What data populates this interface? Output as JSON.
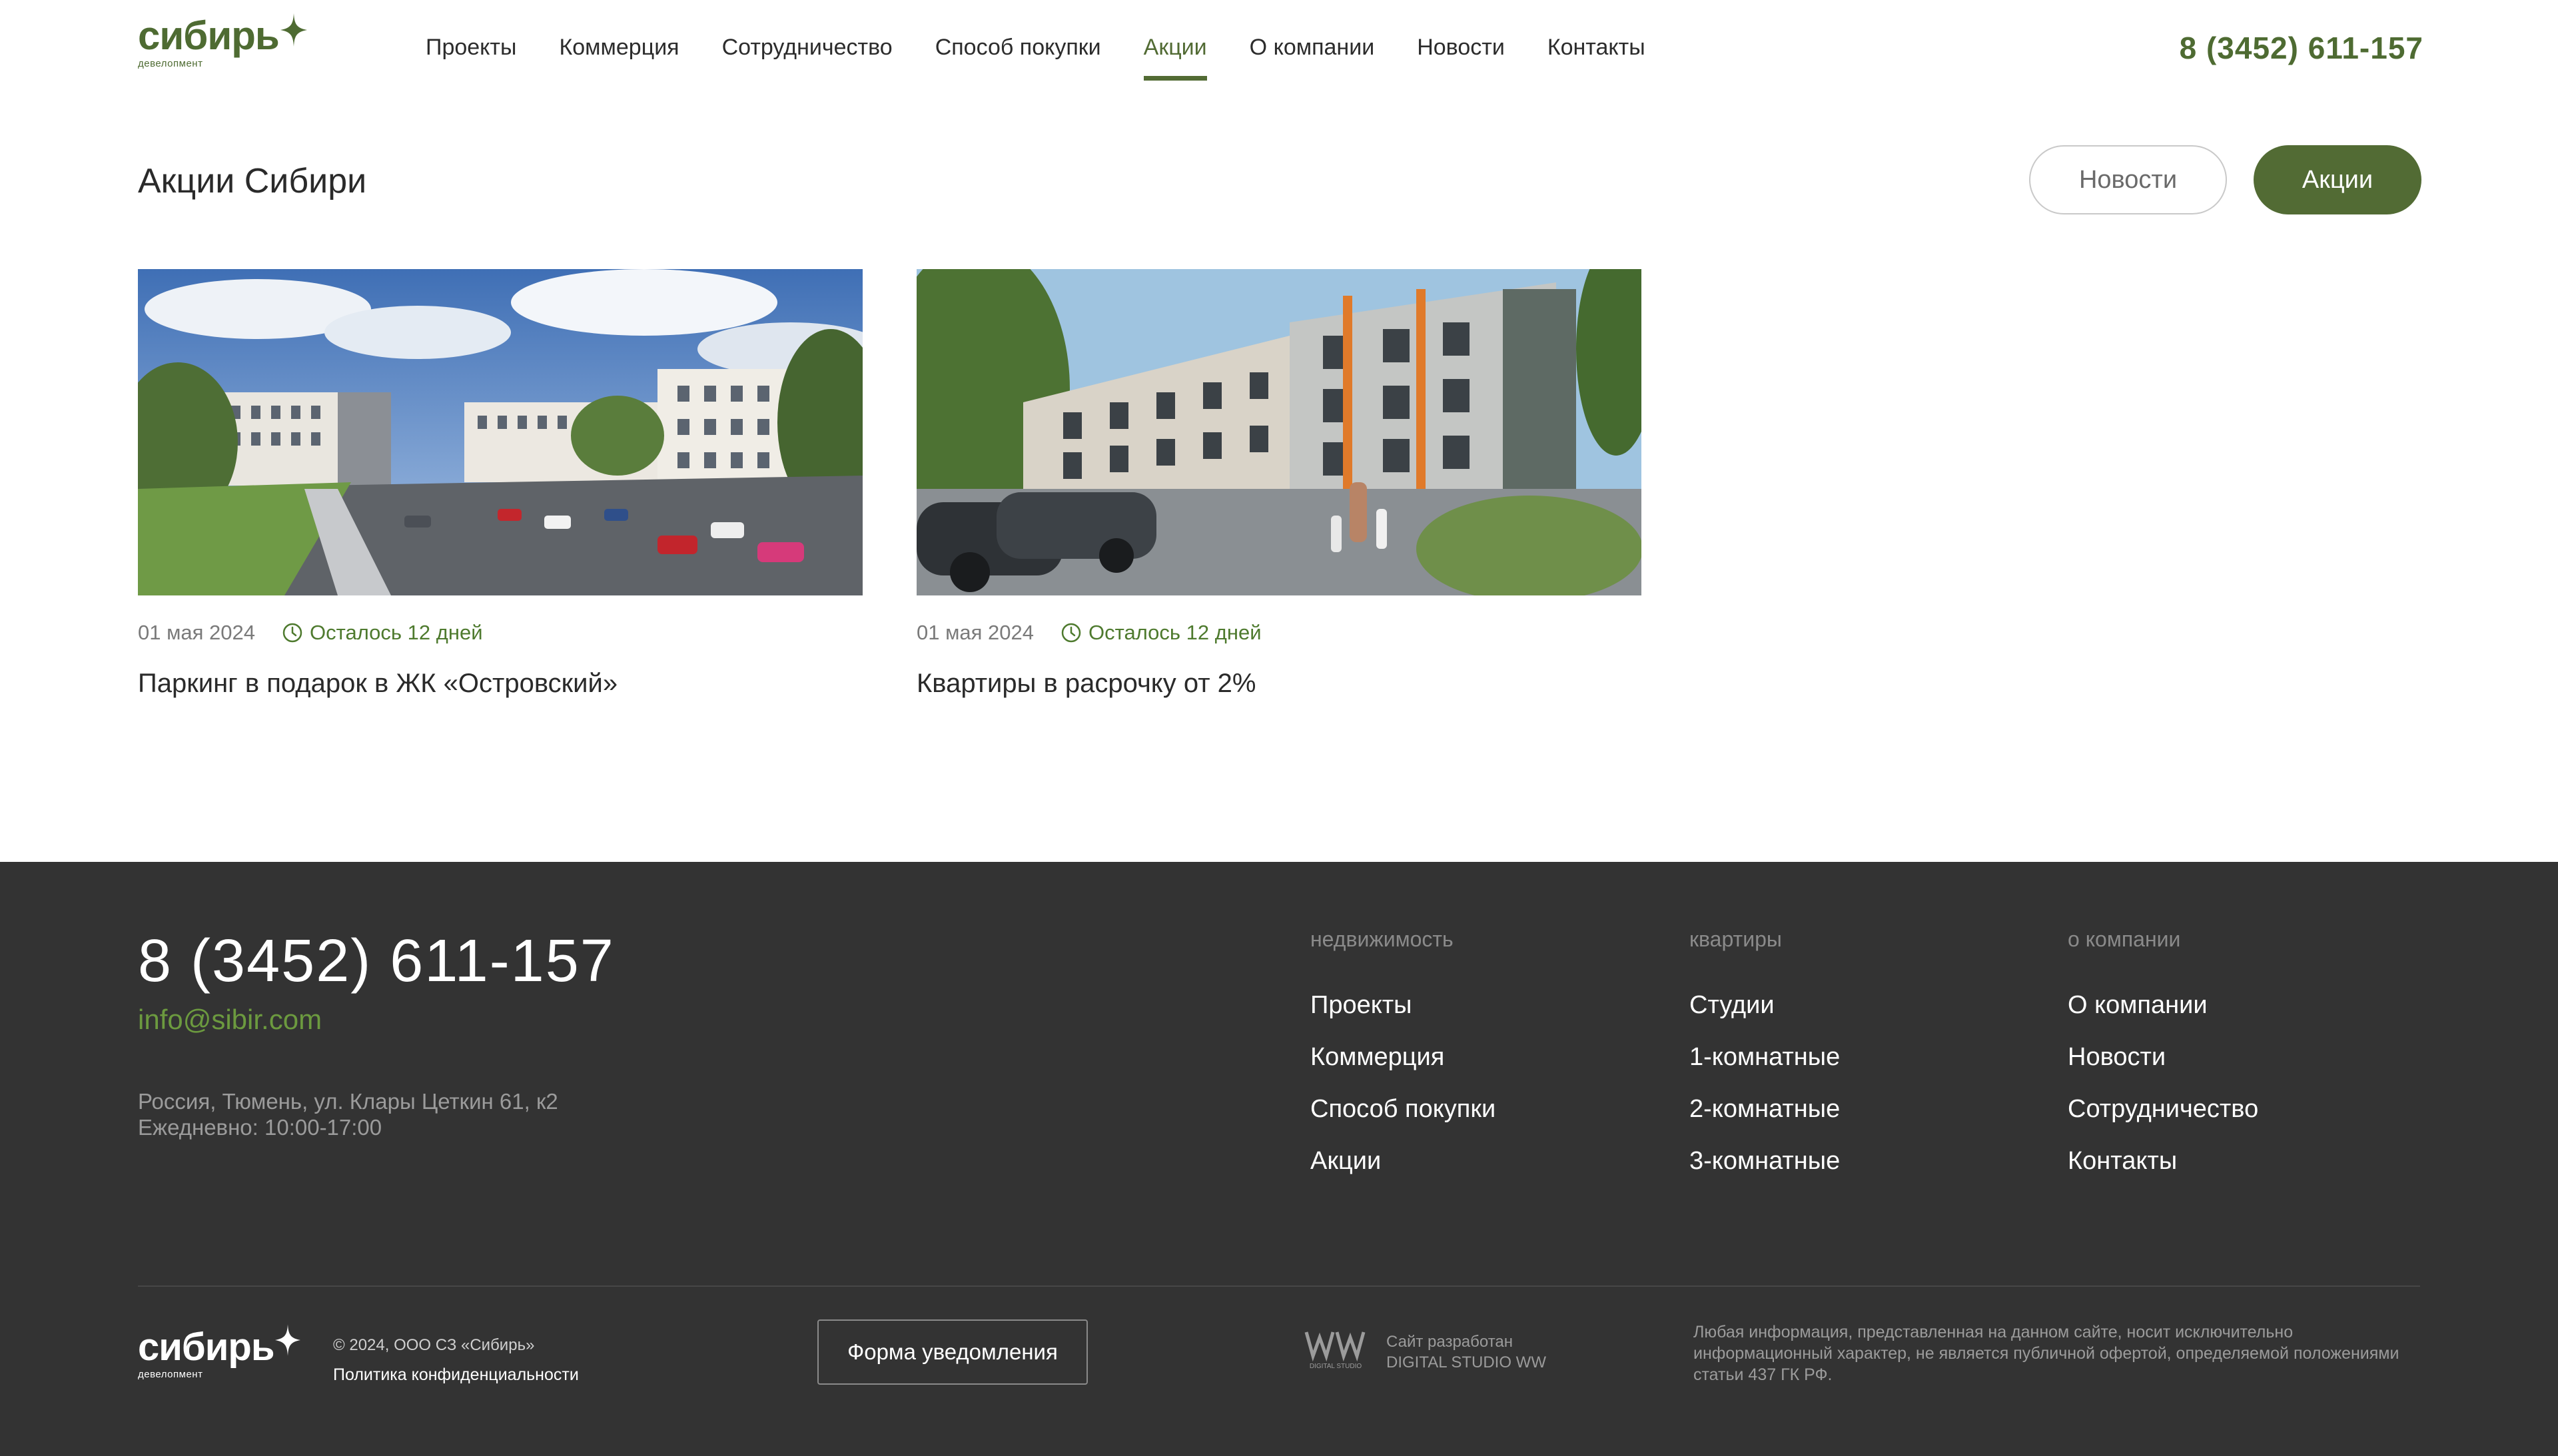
{
  "brand": {
    "logo_word": "сибирь",
    "logo_sub": "девелопмент",
    "accent": "#526b34"
  },
  "nav": {
    "items": [
      "Проекты",
      "Коммерция",
      "Сотрудничество",
      "Способ покупки",
      "Акции",
      "О компании",
      "Новости",
      "Контакты"
    ],
    "active": "Акции"
  },
  "header": {
    "phone": "8 (3452) 611-157"
  },
  "page": {
    "title": "Акции Сибири",
    "filter_news": "Новости",
    "filter_promo": "Акции"
  },
  "cards": [
    {
      "date": "01 мая 2024",
      "remaining": "Осталось 12 дней",
      "title": "Паркинг в подарок в ЖК «Островский»"
    },
    {
      "date": "01 мая 2024",
      "remaining": "Осталось 12 дней",
      "title": "Квартиры в расрочку от 2%"
    }
  ],
  "footer": {
    "phone": "8 (3452) 611-157",
    "email": "info@sibir.com",
    "address": "Россия, Тюмень, ул. Клары Цеткин 61, к2",
    "hours": "Ежедневно: 10:00-17:00",
    "columns": [
      {
        "heading": "недвижимость",
        "items": [
          "Проекты",
          "Коммерция",
          "Способ покупки",
          "Акции"
        ]
      },
      {
        "heading": "квартиры",
        "items": [
          "Студии",
          "1-комнатные",
          "2-комнатные",
          "3-комнатные"
        ]
      },
      {
        "heading": "о компании",
        "items": [
          "О компании",
          "Новости",
          "Сотрудничество",
          "Контакты"
        ]
      }
    ],
    "copyright": "© 2024, ООО СЗ «Сибирь»",
    "policy": "Политика конфиденциальности",
    "form_button": "Форма уведомления",
    "studio_line1": "Сайт разработан",
    "studio_line2": "DIGITAL STUDIO WW",
    "studio_logo_text": "DIGITAL STUDIO",
    "legal": "Любая информация, представленная на данном сайте, носит исключительно информационный характер, не является публичной офертой, определяемой положениями статьи 437 ГК РФ."
  }
}
